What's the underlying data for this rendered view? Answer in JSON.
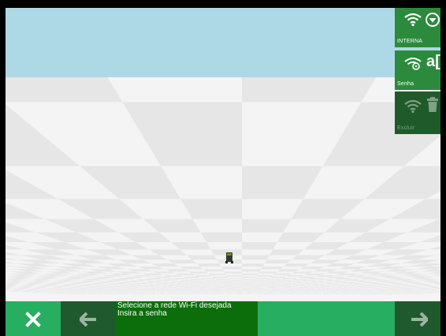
{
  "side_panel": {
    "wifi_network": {
      "label": "INTERNA",
      "icons": [
        "wifi-icon",
        "dropdown-circle-icon"
      ]
    },
    "password": {
      "label": "Senha",
      "icons": [
        "wifi-lock-icon",
        "text-input-icon"
      ],
      "text_glyph": "a["
    },
    "delete": {
      "label": "Excluir",
      "icons": [
        "wifi-icon",
        "trash-icon"
      ]
    }
  },
  "bottom_bar": {
    "message_line1": "Selecione a rede Wi-Fi desejada",
    "message_line2": "Insira a senha",
    "close_icon": "close-icon",
    "back_icon": "arrow-left-icon",
    "next_icon": "arrow-right-icon"
  },
  "colors": {
    "sky": "#add8e6",
    "floor_light": "#f4f4f4",
    "floor_dark": "#e6e6e6",
    "green": "#27ae60",
    "dark_green": "#1f5a2f",
    "message_green": "#0b6e0b"
  }
}
